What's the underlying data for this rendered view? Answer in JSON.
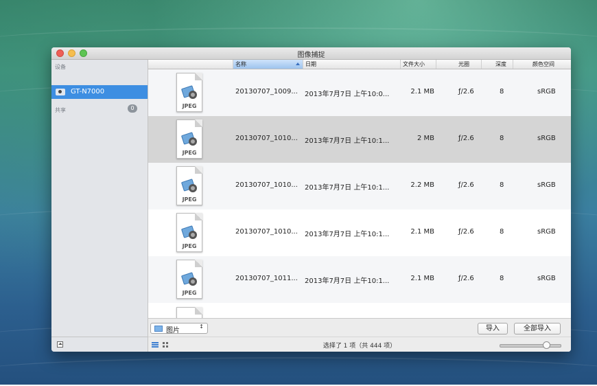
{
  "window": {
    "title": "图像捕捉"
  },
  "sidebar": {
    "devices_header": "设备",
    "device_name": "GT-N7000",
    "shared_header": "共享",
    "shared_count": "0"
  },
  "columns": {
    "name": "名称",
    "date": "日期",
    "size": "文件大小",
    "aperture": "光圈",
    "depth": "深度",
    "colorspace": "颜色空间"
  },
  "files": [
    {
      "type": "JPEG",
      "name": "20130707_1009...",
      "date": "2013年7月7日 上午10:0...",
      "size": "2.1 MB",
      "aperture": "ƒ/2.6",
      "depth": "8",
      "colorspace": "sRGB",
      "selected": false
    },
    {
      "type": "JPEG",
      "name": "20130707_1010...",
      "date": "2013年7月7日 上午10:1...",
      "size": "2 MB",
      "aperture": "ƒ/2.6",
      "depth": "8",
      "colorspace": "sRGB",
      "selected": true
    },
    {
      "type": "JPEG",
      "name": "20130707_1010...",
      "date": "2013年7月7日 上午10:1...",
      "size": "2.2 MB",
      "aperture": "ƒ/2.6",
      "depth": "8",
      "colorspace": "sRGB",
      "selected": false
    },
    {
      "type": "JPEG",
      "name": "20130707_1010...",
      "date": "2013年7月7日 上午10:1...",
      "size": "2.1 MB",
      "aperture": "ƒ/2.6",
      "depth": "8",
      "colorspace": "sRGB",
      "selected": false
    },
    {
      "type": "JPEG",
      "name": "20130707_1011...",
      "date": "2013年7月7日 上午10:1...",
      "size": "2.1 MB",
      "aperture": "ƒ/2.6",
      "depth": "8",
      "colorspace": "sRGB",
      "selected": false
    }
  ],
  "import_bar": {
    "destination": "图片",
    "import_label": "导入",
    "import_all_label": "全部导入"
  },
  "status_bar": {
    "status_text": "选择了 1 项（共 444 项）",
    "thumbnail_size_level": 0.8
  },
  "colors": {
    "selection_blue": "#3d8ee2",
    "selected_row": "#d5d5d5"
  },
  "icons": {
    "device": "camera-icon",
    "file": "jpeg-file-icon",
    "folder": "pictures-folder-icon",
    "eject": "eject-icon",
    "list_view": "list-view-icon",
    "grid_view": "grid-view-icon"
  }
}
